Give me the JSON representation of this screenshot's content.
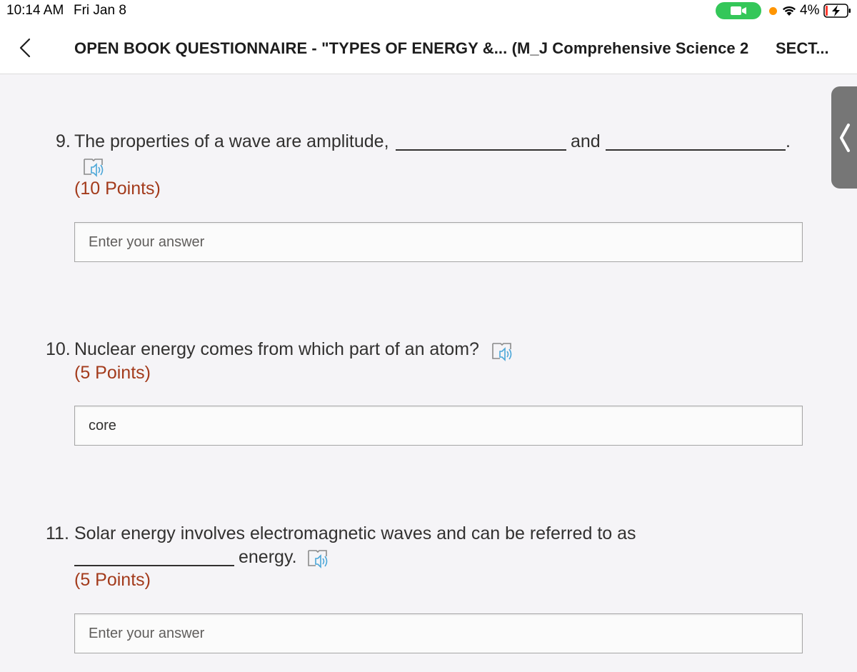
{
  "status_bar": {
    "time": "10:14 AM",
    "date": "Fri Jan 8",
    "battery_percent": "4%",
    "icons": [
      "video-camera-icon",
      "wifi-icon",
      "battery-charging-icon"
    ]
  },
  "header": {
    "title": "OPEN BOOK QUESTIONNAIRE - \"TYPES OF ENERGY &... (M_J Comprehensive Science 2",
    "section": "SECT..."
  },
  "questions": [
    {
      "number": "9.",
      "text_part1": "The properties of a wave are amplitude,",
      "text_part2": "and",
      "text_end": ".",
      "points": "(10 Points)",
      "answer_value": "",
      "answer_placeholder": "Enter your answer"
    },
    {
      "number": "10.",
      "text": "Nuclear energy comes from which part of an atom?",
      "points": "(5 Points)",
      "answer_value": "core",
      "answer_placeholder": "Enter your answer"
    },
    {
      "number": "11.",
      "text_part1": "Solar energy involves electromagnetic waves and can be referred to as",
      "text_part2": "energy.",
      "points": "(5 Points)",
      "answer_value": "",
      "answer_placeholder": "Enter your answer"
    }
  ],
  "colors": {
    "points": "#a33b1c",
    "immersive_reader_icon": "#4aa6d8",
    "status_camera": "#34c759",
    "status_dot": "#ff9500"
  }
}
